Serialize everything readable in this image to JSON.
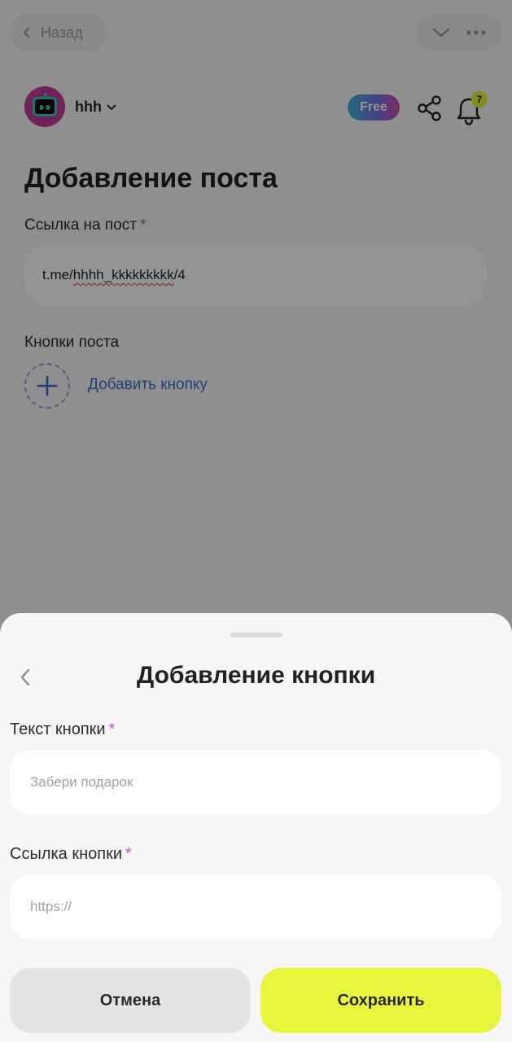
{
  "nav": {
    "back_label": "Назад"
  },
  "header": {
    "account_name": "hhh",
    "plan_badge": "Free",
    "notifications_count": "7"
  },
  "page": {
    "title": "Добавление поста",
    "post_link_label": "Ссылка на пост",
    "required_mark": "*",
    "post_link_prefix": "t.me/",
    "post_link_channel": "hhhh_kkkkkkkkk",
    "post_link_suffix": "/4",
    "post_buttons_label": "Кнопки поста",
    "add_button_label": "Добавить кнопку"
  },
  "sheet": {
    "title": "Добавление кнопки",
    "button_text_label": "Текст кнопки",
    "button_text_placeholder": "Забери подарок",
    "button_link_label": "Ссылка кнопки",
    "button_link_placeholder": "https://",
    "cancel_label": "Отмена",
    "save_label": "Сохранить"
  },
  "colors": {
    "accent_save": "#e7f53d",
    "required": "#d24ec8",
    "link": "#3a6fd0"
  }
}
